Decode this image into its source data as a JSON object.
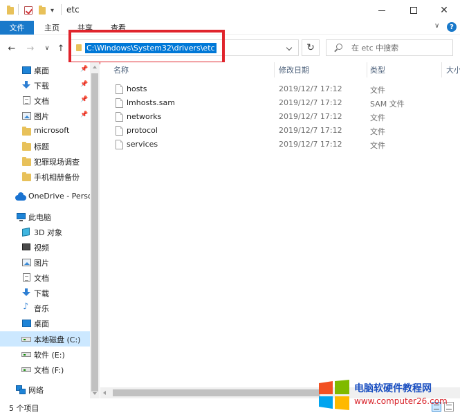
{
  "window": {
    "title": "etc",
    "minimize_glyph": "—",
    "maximize_glyph": "☐",
    "close_glyph": "✕"
  },
  "ribbon": {
    "file_tab": "文件",
    "tabs": [
      "主页",
      "共享",
      "查看"
    ],
    "expand_glyph": "∨",
    "help_glyph": "?"
  },
  "navigation": {
    "back_glyph": "←",
    "forward_glyph": "→",
    "recent_glyph": "∨",
    "up_glyph": "↑",
    "refresh_glyph": "↻"
  },
  "address": {
    "path": "C:\\Windows\\System32\\drivers\\etc"
  },
  "search": {
    "placeholder": "在 etc 中搜索"
  },
  "sidebar": {
    "items": [
      {
        "label": "桌面",
        "icon": "desktop-icon",
        "pinned": true
      },
      {
        "label": "下载",
        "icon": "download-icon",
        "pinned": true
      },
      {
        "label": "文档",
        "icon": "document-icon",
        "pinned": true
      },
      {
        "label": "图片",
        "icon": "picture-icon",
        "pinned": true
      },
      {
        "label": "microsoft",
        "icon": "folder-icon",
        "pinned": false
      },
      {
        "label": "标题",
        "icon": "folder-icon",
        "pinned": false
      },
      {
        "label": "犯罪现场调查",
        "icon": "folder-icon",
        "pinned": false
      },
      {
        "label": "手机相册备份",
        "icon": "folder-icon",
        "pinned": false
      },
      {
        "label": "OneDrive - Perso",
        "icon": "onedrive-icon",
        "pinned": false
      },
      {
        "label": "此电脑",
        "icon": "this-pc-icon",
        "pinned": false
      },
      {
        "label": "3D 对象",
        "icon": "3d-objects-icon",
        "pinned": false
      },
      {
        "label": "视频",
        "icon": "video-icon",
        "pinned": false
      },
      {
        "label": "图片",
        "icon": "picture-icon",
        "pinned": false
      },
      {
        "label": "文档",
        "icon": "document-icon",
        "pinned": false
      },
      {
        "label": "下载",
        "icon": "download-icon",
        "pinned": false
      },
      {
        "label": "音乐",
        "icon": "music-icon",
        "pinned": false
      },
      {
        "label": "桌面",
        "icon": "desktop-icon",
        "pinned": false
      },
      {
        "label": "本地磁盘 (C:)",
        "icon": "drive-icon",
        "pinned": false,
        "selected": true
      },
      {
        "label": "软件 (E:)",
        "icon": "drive-icon",
        "pinned": false
      },
      {
        "label": "文档 (F:)",
        "icon": "drive-icon",
        "pinned": false
      },
      {
        "label": "网络",
        "icon": "network-icon",
        "pinned": false
      }
    ],
    "pin_glyph": "📌"
  },
  "file_list": {
    "columns": [
      "名称",
      "修改日期",
      "类型",
      "大小"
    ],
    "rows": [
      {
        "name": "hosts",
        "modified": "2019/12/7 17:12",
        "type": "文件"
      },
      {
        "name": "lmhosts.sam",
        "modified": "2019/12/7 17:12",
        "type": "SAM 文件"
      },
      {
        "name": "networks",
        "modified": "2019/12/7 17:12",
        "type": "文件"
      },
      {
        "name": "protocol",
        "modified": "2019/12/7 17:12",
        "type": "文件"
      },
      {
        "name": "services",
        "modified": "2019/12/7 17:12",
        "type": "文件"
      }
    ]
  },
  "status": {
    "item_count": "5 个项目"
  },
  "watermark": {
    "title": "电脑软硬件教程网",
    "url": "www.computer26.com"
  },
  "colors": {
    "accent": "#1979ca",
    "selection": "#0078d7",
    "highlight_box": "#e0242c"
  }
}
